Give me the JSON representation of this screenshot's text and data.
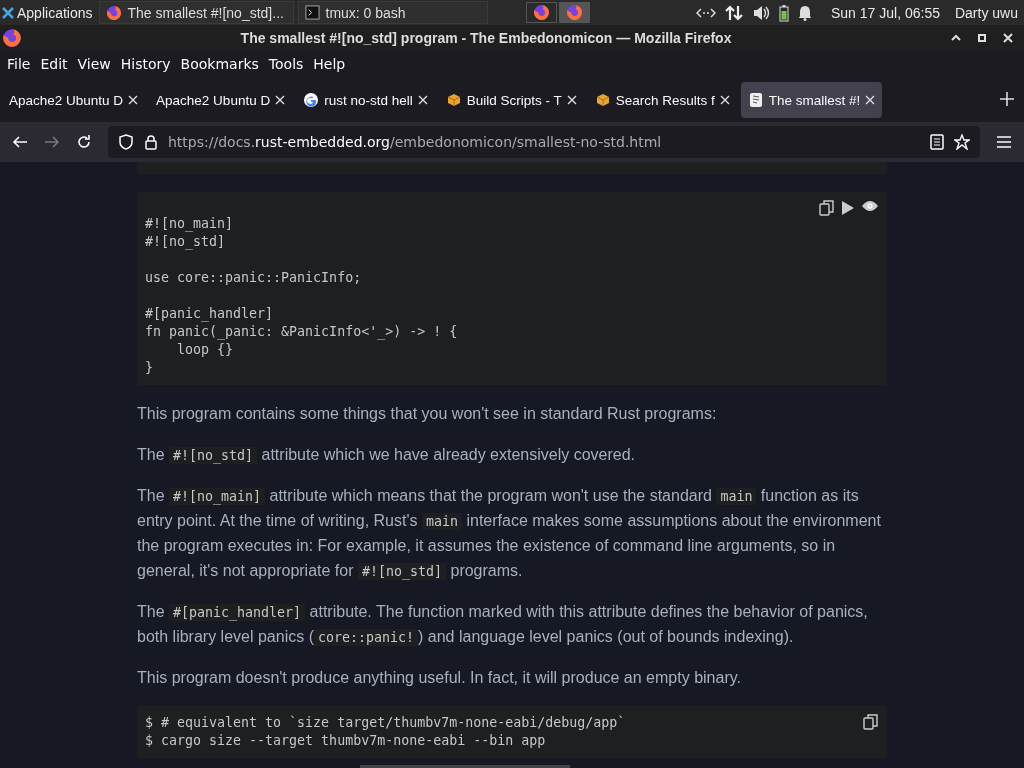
{
  "taskbar": {
    "apps_menu": "Applications",
    "tasks": [
      "The smallest #![no_std]...",
      "tmux: 0 bash"
    ],
    "workspaces": [
      {
        "selected": false
      },
      {
        "selected": true
      }
    ],
    "clock": "Sun 17 Jul, 06:55",
    "user": "Darty uwu"
  },
  "window": {
    "title": "The smallest #![no_std] program - The Embedonomicon — Mozilla Firefox"
  },
  "menu": [
    "File",
    "Edit",
    "View",
    "History",
    "Bookmarks",
    "Tools",
    "Help"
  ],
  "tabs": [
    {
      "label": "Apache2 Ubuntu D",
      "selected": false
    },
    {
      "label": "Apache2 Ubuntu D",
      "selected": false
    },
    {
      "label": "rust no-std hell",
      "selected": false
    },
    {
      "label": "Build Scripts - T",
      "selected": false
    },
    {
      "label": "Search Results f",
      "selected": false
    },
    {
      "label": "The smallest #!",
      "selected": true
    }
  ],
  "address": {
    "domain_before": "https://docs.",
    "domain": "rust-embedded.org",
    "path": "/embedonomicon/smallest-no-std.html"
  },
  "content": [
    {
      "kind": "code",
      "buttons": true,
      "text": "#![no_main]\n#![no_std]\n\nuse core::panic::PanicInfo;\n\n#[panic_handler]\nfn panic(_panic: &PanicInfo<'_>) -> ! {\n    loop {}\n}"
    },
    {
      "kind": "para",
      "parts": [
        {
          "t": "This program contains some things that you won't see in standard Rust programs:",
          "code": false
        }
      ]
    },
    {
      "kind": "para",
      "parts": [
        {
          "t": "The ",
          "code": false
        },
        {
          "t": "#![no_std]",
          "code": true
        },
        {
          "t": " attribute which we have already extensively covered.",
          "code": false
        }
      ]
    },
    {
      "kind": "para",
      "parts": [
        {
          "t": "The ",
          "code": false
        },
        {
          "t": "#![no_main]",
          "code": true
        },
        {
          "t": " attribute which means that the program won't use the standard ",
          "code": false
        },
        {
          "t": "main",
          "code": true
        },
        {
          "t": " function as its entry point. At the time of writing, Rust's ",
          "code": false
        },
        {
          "t": "main",
          "code": true
        },
        {
          "t": " interface makes some assumptions about the environment the program executes in: For example, it assumes the existence of command line arguments, so in general, it's not appropriate for ",
          "code": false
        },
        {
          "t": "#![no_std]",
          "code": true
        },
        {
          "t": " programs.",
          "code": false
        }
      ]
    },
    {
      "kind": "para",
      "parts": [
        {
          "t": "The ",
          "code": false
        },
        {
          "t": "#[panic_handler]",
          "code": true
        },
        {
          "t": " attribute. The function marked with this attribute defines the behavior of panics, both library level panics (",
          "code": false
        },
        {
          "t": "core::panic!",
          "code": true
        },
        {
          "t": ") and language level panics (out of bounds indexing).",
          "code": false
        }
      ]
    },
    {
      "kind": "para",
      "parts": [
        {
          "t": "This program doesn't produce anything useful. In fact, it will produce an empty binary.",
          "code": false
        }
      ]
    },
    {
      "kind": "code",
      "buttons": false,
      "text": "$ # equivalent to `size target/thumbv7m-none-eabi/debug/app`\n$ cargo size --target thumbv7m-none-eabi --bin app"
    }
  ]
}
